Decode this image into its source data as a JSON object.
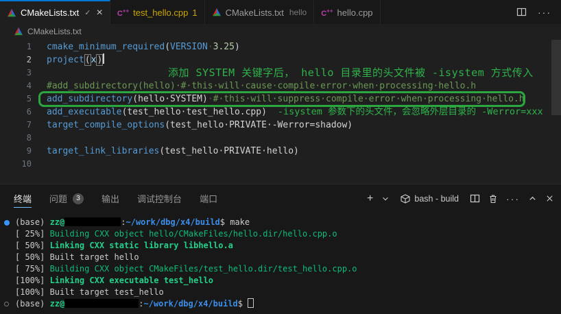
{
  "colors": {
    "accent": "#0078d4",
    "annotation_green": "#2fb34a",
    "highlight_box_green": "#2aa83f",
    "warning_yellow": "#cca700",
    "terminal_green": "#0dbc79",
    "terminal_green_bold": "#23d18b",
    "terminal_blue": "#3b8eea",
    "decoration_blue": "#3794ff"
  },
  "tabbar": {
    "close_glyph": "×",
    "marker_glyph": "✓",
    "tabs": [
      {
        "id": "cmakelists-txt-active",
        "icon": "cmake",
        "label": "CMakeLists.txt",
        "marker": true,
        "close": true,
        "active": true,
        "warn": false,
        "desc": "",
        "count": ""
      },
      {
        "id": "test-hello-cpp",
        "icon": "cpp",
        "label": "test_hello.cpp",
        "marker": false,
        "close": false,
        "active": false,
        "warn": true,
        "desc": "",
        "count": "1"
      },
      {
        "id": "cmakelists-txt-hello",
        "icon": "cmake",
        "label": "CMakeLists.txt",
        "marker": false,
        "close": false,
        "active": false,
        "warn": false,
        "desc": "hello",
        "count": ""
      },
      {
        "id": "hello-cpp",
        "icon": "cpp",
        "label": "hello.cpp",
        "marker": false,
        "close": false,
        "active": false,
        "warn": false,
        "desc": "",
        "count": ""
      }
    ]
  },
  "breadcrumb": {
    "label": "CMakeLists.txt"
  },
  "editor": {
    "lines": [
      {
        "n": "1",
        "cur": false,
        "tokens": [
          [
            "fn",
            "cmake_minimum_required"
          ],
          [
            "pn",
            "("
          ],
          [
            "kw",
            "VERSION"
          ],
          [
            "ws",
            "·"
          ],
          [
            "num",
            "3.25"
          ],
          [
            "pn",
            ")"
          ]
        ]
      },
      {
        "n": "2",
        "cur": true,
        "tokens": [
          [
            "fn",
            "project"
          ],
          [
            "brkt",
            "("
          ],
          [
            "var",
            "x"
          ],
          [
            "brkt",
            ")"
          ],
          [
            "cursor",
            ""
          ]
        ]
      },
      {
        "n": "3",
        "cur": false,
        "tokens": [
          [
            "ann3",
            "添加 SYSTEM 关键字后， hello 目录里的头文件被 -isystem 方式传入"
          ]
        ]
      },
      {
        "n": "4",
        "cur": false,
        "tokens": [
          [
            "cm",
            "#add_subdirectory(hello)·#·this·will·cause·compile·error·when·processing·hello.h"
          ]
        ]
      },
      {
        "n": "5",
        "cur": false,
        "tokens": [
          [
            "fn",
            "add_subdirectory"
          ],
          [
            "pn",
            "("
          ],
          [
            "arg",
            "hello·SYSTEM"
          ],
          [
            "pn",
            ")"
          ],
          [
            "ws",
            "·"
          ],
          [
            "cm",
            "#·this·will·suppress·compile·error·when·processing·hello.h"
          ]
        ]
      },
      {
        "n": "6",
        "cur": false,
        "tokens": [
          [
            "fn",
            "add_executable"
          ],
          [
            "pn",
            "("
          ],
          [
            "arg",
            "test_hello·test_hello.cpp"
          ],
          [
            "pn",
            ")"
          ],
          [
            "ann6",
            "-isystem 参数下的头文件，会忽略外层目录的 -Werror=xxx"
          ]
        ]
      },
      {
        "n": "7",
        "cur": false,
        "tokens": [
          [
            "fn",
            "target_compile_options"
          ],
          [
            "pn",
            "("
          ],
          [
            "arg",
            "test_hello·PRIVATE·-Werror=shadow"
          ],
          [
            "pn",
            ")"
          ]
        ]
      },
      {
        "n": "8",
        "cur": false,
        "tokens": []
      },
      {
        "n": "9",
        "cur": false,
        "tokens": [
          [
            "fn",
            "target_link_libraries"
          ],
          [
            "pn",
            "("
          ],
          [
            "arg",
            "test_hello·PRIVATE·hello"
          ],
          [
            "pn",
            ")"
          ]
        ]
      },
      {
        "n": "10",
        "cur": false,
        "tokens": []
      }
    ]
  },
  "panel": {
    "tabs": [
      {
        "label": "终端",
        "active": true,
        "badge": ""
      },
      {
        "label": "问题",
        "active": false,
        "badge": "3"
      },
      {
        "label": "输出",
        "active": false,
        "badge": ""
      },
      {
        "label": "调试控制台",
        "active": false,
        "badge": ""
      },
      {
        "label": "端口",
        "active": false,
        "badge": ""
      }
    ],
    "terminal_title": "bash - build",
    "plus_label": "+"
  },
  "terminal": {
    "lines": [
      {
        "deco": "filled",
        "segs": [
          [
            "wh",
            "(base) "
          ],
          [
            "gb",
            "zz@"
          ],
          [
            "redact",
            "82"
          ],
          [
            "wh",
            ":"
          ],
          [
            "bb",
            "~/work/dbg/x4/build"
          ],
          [
            "wh",
            "$ make"
          ]
        ]
      },
      {
        "deco": "",
        "segs": [
          [
            "wh",
            "[ 25%] "
          ],
          [
            "gr",
            "Building CXX object hello/CMakeFiles/hello.dir/hello.cpp.o"
          ]
        ]
      },
      {
        "deco": "",
        "segs": [
          [
            "wh",
            "[ 50%] "
          ],
          [
            "gb",
            "Linking CXX static library libhello.a"
          ]
        ]
      },
      {
        "deco": "",
        "segs": [
          [
            "wh",
            "[ 50%] Built target hello"
          ]
        ]
      },
      {
        "deco": "",
        "segs": [
          [
            "wh",
            "[ 75%] "
          ],
          [
            "gr",
            "Building CXX object CMakeFiles/test_hello.dir/test_hello.cpp.o"
          ]
        ]
      },
      {
        "deco": "",
        "segs": [
          [
            "wh",
            "[100%] "
          ],
          [
            "gb",
            "Linking CXX executable test_hello"
          ]
        ]
      },
      {
        "deco": "",
        "segs": [
          [
            "wh",
            "[100%] Built target test_hello"
          ]
        ]
      },
      {
        "deco": "hollow",
        "segs": [
          [
            "wh",
            "(base) "
          ],
          [
            "gb",
            "zz@"
          ],
          [
            "redact",
            "108"
          ],
          [
            "wh",
            ":"
          ],
          [
            "bb",
            "~/work/dbg/x4/build"
          ],
          [
            "wh",
            "$ "
          ],
          [
            "cursor",
            ""
          ]
        ]
      }
    ]
  }
}
